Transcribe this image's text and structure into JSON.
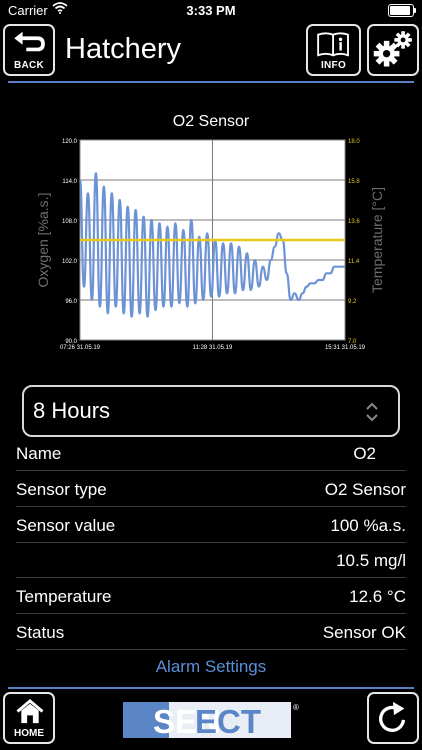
{
  "status_bar": {
    "carrier": "Carrier",
    "time": "3:33 PM",
    "battery_level": 1.0
  },
  "header": {
    "title": "Hatchery",
    "back_label": "BACK",
    "info_label": "INFO"
  },
  "chart_data": {
    "type": "line",
    "title": "O2 Sensor",
    "y_left_label": "Oxygen [%a.s.]",
    "y_right_label": "Temperature [°C]",
    "y_left_ticks": [
      "120.0",
      "114.0",
      "108.0",
      "102.0",
      "96.0",
      "90.0"
    ],
    "y_right_ticks": [
      "18.0",
      "15.8",
      "13.6",
      "11.4",
      "9.2",
      "7.0"
    ],
    "ylim_left": [
      90,
      120
    ],
    "ylim_right": [
      7,
      18
    ],
    "x_ticks": [
      "07:26 31.05.19",
      "11:28 31.05.19",
      "15:31 31.05.19"
    ],
    "grid": true,
    "colors": {
      "oxygen": "#6b93d6",
      "temperature": "#e8c81a",
      "axis": "#8a8a8a",
      "grid": "#7a7a7a"
    },
    "series": [
      {
        "key": "oxygen",
        "axis": "left",
        "x": [
          0,
          0.015,
          0.03,
          0.045,
          0.06,
          0.075,
          0.09,
          0.105,
          0.12,
          0.135,
          0.15,
          0.165,
          0.18,
          0.195,
          0.21,
          0.225,
          0.24,
          0.255,
          0.27,
          0.285,
          0.3,
          0.315,
          0.33,
          0.345,
          0.36,
          0.375,
          0.39,
          0.405,
          0.42,
          0.435,
          0.45,
          0.465,
          0.48,
          0.495,
          0.51,
          0.525,
          0.54,
          0.555,
          0.57,
          0.585,
          0.6,
          0.615,
          0.63,
          0.645,
          0.66,
          0.675,
          0.69,
          0.705,
          0.72,
          0.735,
          0.75,
          0.765,
          0.78,
          0.795,
          0.81,
          0.825,
          0.84,
          0.855,
          0.87,
          0.885,
          0.9,
          0.915,
          0.93,
          0.945,
          0.96,
          0.975,
          1.0
        ],
        "values": [
          114,
          98,
          112,
          96,
          115,
          95,
          113,
          94,
          112,
          95,
          111,
          94,
          110,
          93.5,
          109.5,
          94,
          108.5,
          93.5,
          108,
          94.5,
          107.5,
          95,
          107,
          95,
          107.5,
          95.5,
          106.5,
          95,
          108,
          95.5,
          105.5,
          96,
          106,
          96.5,
          105,
          96.5,
          104.5,
          97,
          104.5,
          97,
          104,
          97.5,
          103,
          97.5,
          102,
          98,
          101,
          99,
          102,
          104,
          106,
          105,
          100,
          96,
          97,
          96,
          97,
          98,
          98.5,
          98.5,
          99,
          99,
          100,
          100,
          101,
          101,
          101
        ]
      },
      {
        "key": "temperature",
        "axis": "right",
        "x": [
          0,
          1
        ],
        "values": [
          12.5,
          12.5
        ]
      }
    ]
  },
  "interval_select": {
    "value": "8 Hours"
  },
  "details": [
    {
      "key": "Name",
      "value": "O2"
    },
    {
      "key": "Sensor type",
      "value": "O2 Sensor"
    },
    {
      "key": "Sensor value",
      "value": "100 %a.s."
    },
    {
      "key": "",
      "value": "10.5 mg/l"
    },
    {
      "key": "Temperature",
      "value": "12.6 °C"
    },
    {
      "key": "Status",
      "value": "Sensor OK"
    }
  ],
  "alarm_settings": "Alarm Settings",
  "footer": {
    "home_label": "HOME",
    "logo_text": "SENECT",
    "logo_mark": "®"
  },
  "accent": "#5a7fc4"
}
